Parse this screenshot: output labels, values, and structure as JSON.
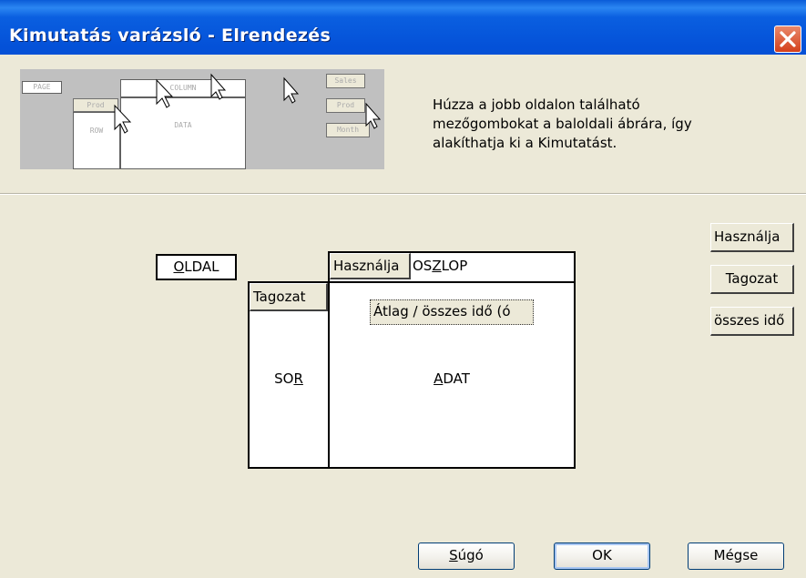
{
  "window": {
    "title": "Kimutatás varázsló - Elrendezés"
  },
  "preview": {
    "page_label": "PAGE",
    "column_label": "COLUMN",
    "row_label": "ROW",
    "data_label": "DATA",
    "prod_label": "Prod",
    "sales_label": "Sales",
    "month_label": "Month"
  },
  "instructions": "Húzza a jobb oldalon található mezőgombokat a baloldali ábrára, így alakíthatja ki a Kimutatást.",
  "layout": {
    "page_area": {
      "pre": "",
      "ul": "O",
      "post": "LDAL"
    },
    "column_area": {
      "pre": "OS",
      "ul": "Z",
      "post": "LOP"
    },
    "row_area": {
      "pre": "SO",
      "ul": "R",
      "post": ""
    },
    "data_area": {
      "pre": "",
      "ul": "A",
      "post": "DAT"
    },
    "column_field": "Használja",
    "row_field": "Tagozat",
    "data_field": "Átlag / összes idő (ó"
  },
  "available_fields": [
    "Használja",
    "Tagozat",
    "összes idő"
  ],
  "buttons": {
    "help": {
      "pre": "",
      "ul": "S",
      "post": "úgó"
    },
    "ok": "OK",
    "cancel": "Mégse"
  }
}
